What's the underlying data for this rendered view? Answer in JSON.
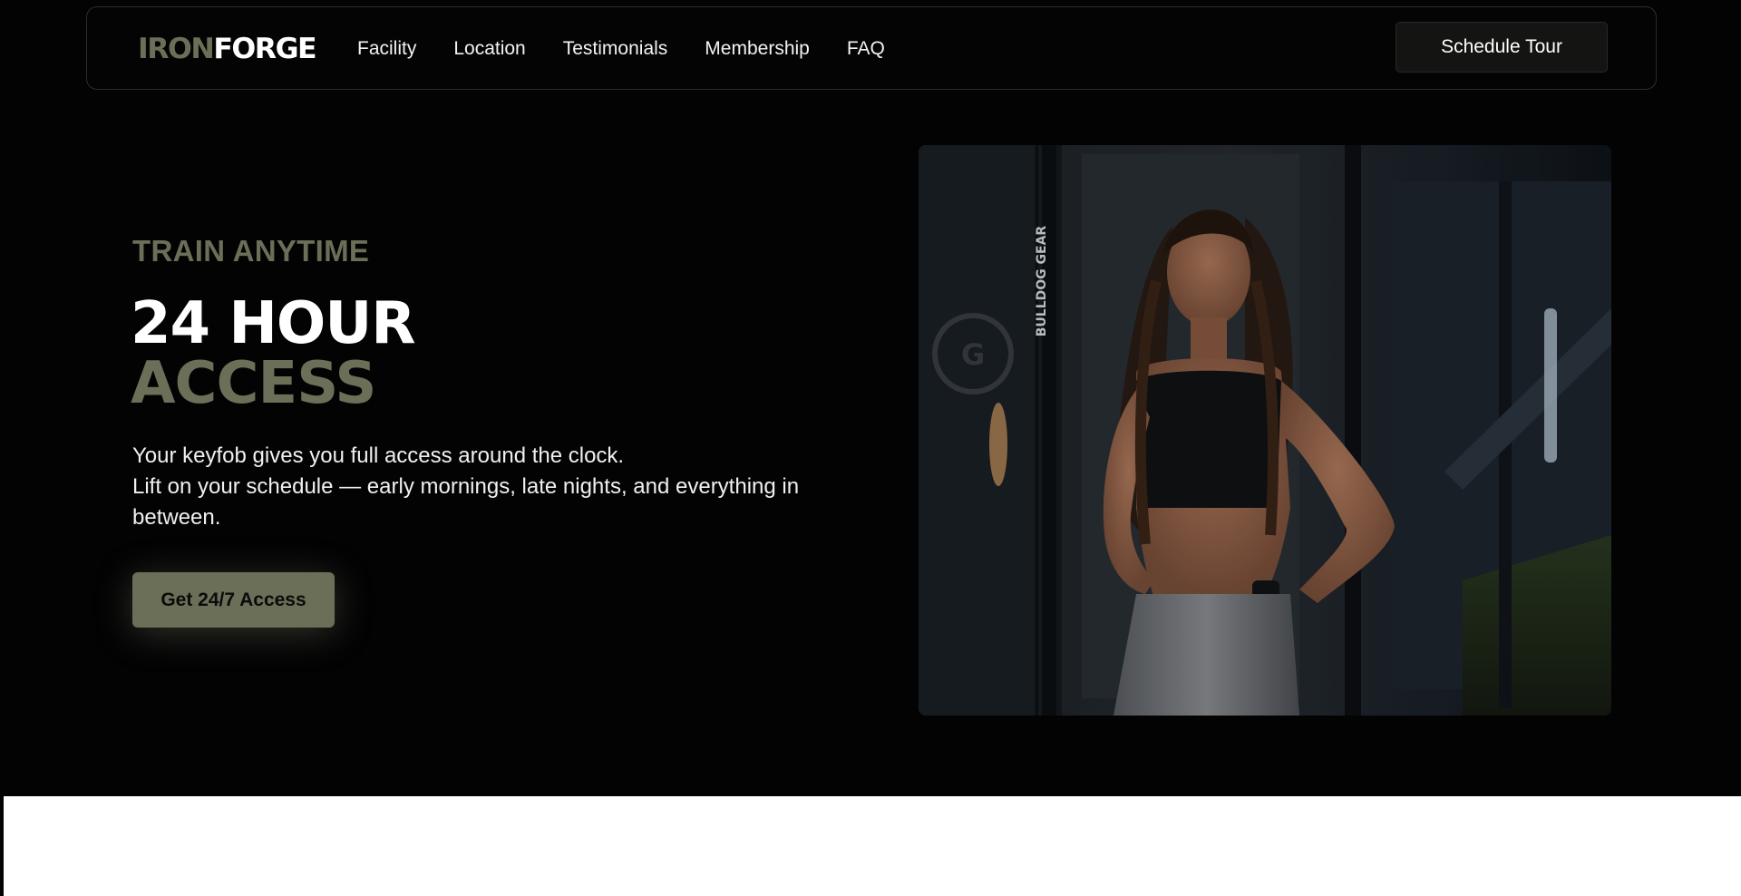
{
  "brand": {
    "logo_part_a": "IRON",
    "logo_part_b": "FORGE"
  },
  "nav": {
    "links": [
      "Facility",
      "Location",
      "Testimonials",
      "Membership",
      "FAQ"
    ],
    "cta_label": "Schedule Tour"
  },
  "hero": {
    "eyebrow": "TRAIN ANYTIME",
    "headline_line1": "24 HOUR",
    "headline_line2": "ACCESS",
    "description_line1": "Your keyfob gives you full access around the clock.",
    "description_line2": "Lift on your schedule — early mornings, late nights, and everything in between.",
    "cta_label": "Get 24/7 Access",
    "image_rack_text": "BULLDOG GEAR"
  },
  "colors": {
    "background": "#030304",
    "accent": "#6b6f57",
    "text": "#ffffff",
    "button_dark": "#141412"
  }
}
